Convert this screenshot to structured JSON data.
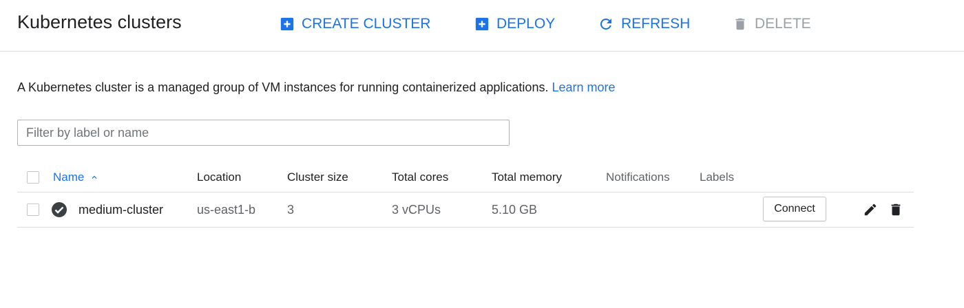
{
  "colors": {
    "accent": "#1a73e8",
    "disabled": "#9aa0a6",
    "status_ok": "#3c4043",
    "text": "#202124"
  },
  "header": {
    "title": "Kubernetes clusters",
    "actions": [
      {
        "label": "CREATE CLUSTER",
        "icon": "add-box-icon",
        "enabled": true
      },
      {
        "label": "DEPLOY",
        "icon": "add-box-icon",
        "enabled": true
      },
      {
        "label": "REFRESH",
        "icon": "refresh-icon",
        "enabled": true
      },
      {
        "label": "DELETE",
        "icon": "trash-icon",
        "enabled": false
      }
    ]
  },
  "description": {
    "text": "A Kubernetes cluster is a managed group of VM instances for running containerized applications.",
    "link": "Learn more"
  },
  "filter": {
    "placeholder": "Filter by label or name",
    "value": ""
  },
  "table": {
    "columns": [
      "Name",
      "Location",
      "Cluster size",
      "Total cores",
      "Total memory",
      "Notifications",
      "Labels"
    ],
    "sorted_by": "Name",
    "sort_direction": "ascending",
    "sort_icon": "chevron-up-icon",
    "rows": [
      {
        "status_icon": "check-circle-icon",
        "status": "ok",
        "name": "medium-cluster",
        "location": "us-east1-b",
        "cluster_size": "3",
        "total_cores": "3 vCPUs",
        "total_memory": "5.10 GB",
        "notifications": "",
        "labels": "",
        "connect_label": "Connect",
        "row_actions": [
          "edit-icon",
          "trash-icon"
        ]
      }
    ]
  }
}
